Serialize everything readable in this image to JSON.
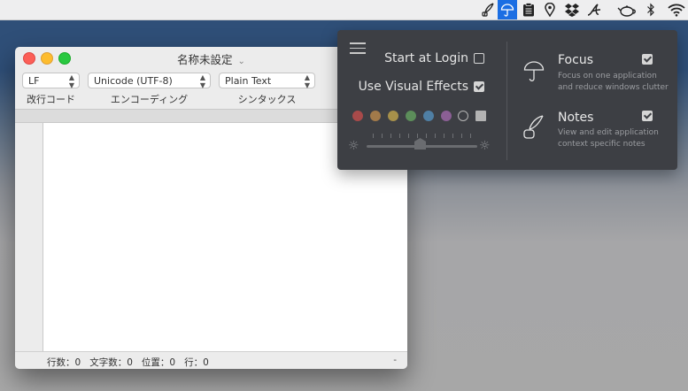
{
  "menubar": {
    "icons": [
      "quill-icon",
      "umbrella-icon",
      "clipboard-icon",
      "location-pin-icon",
      "dropbox-icon",
      "script-a-icon",
      "teapot-icon",
      "bluetooth-icon",
      "wifi-icon"
    ],
    "active_icon": "umbrella-icon",
    "active_color": "#1b6ee3"
  },
  "window": {
    "title": "名称未設定",
    "title_chevron": "⌄",
    "line_ending": {
      "value": "LF",
      "caption": "改行コード"
    },
    "encoding": {
      "value": "Unicode (UTF-8)",
      "caption": "エンコーディング"
    },
    "syntax": {
      "value": "Plain Text",
      "caption": "シンタックス"
    },
    "status": "行数：0   文字数：0   位置：0   行：0",
    "status_right": "-"
  },
  "panel": {
    "start_at_login": {
      "label": "Start at Login",
      "checked": false
    },
    "visual_effects": {
      "label": "Use Visual Effects",
      "checked": true
    },
    "color_swatches": [
      "#a84a4a",
      "#a27a4a",
      "#a6904a",
      "#5c8e5a",
      "#4f7fa4",
      "#8b5f95"
    ],
    "brightness": 0.48,
    "features": [
      {
        "icon": "umbrella-icon",
        "title": "Focus",
        "desc_line1": "Focus on one application",
        "desc_line2": "and reduce windows clutter",
        "checked": true
      },
      {
        "icon": "quill-icon",
        "title": "Notes",
        "desc_line1": "View and edit application",
        "desc_line2": "context specific notes",
        "checked": true
      }
    ]
  }
}
